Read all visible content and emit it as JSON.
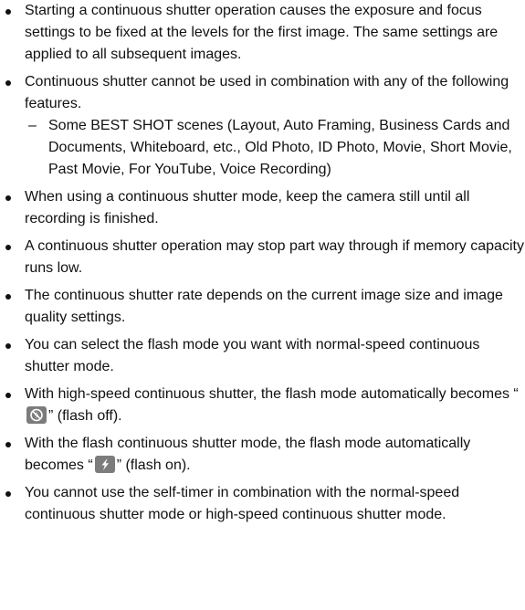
{
  "notes": [
    {
      "text": "Starting a continuous shutter operation causes the exposure and focus settings to be fixed at the levels for the first image. The same settings are applied to all subsequent images."
    },
    {
      "text": "Continuous shutter cannot be used in combination with any of the following features.",
      "sub": [
        "Some BEST SHOT scenes (Layout, Auto Framing, Business Cards and Documents, Whiteboard, etc., Old Photo, ID Photo, Movie, Short Movie, Past Movie, For YouTube, Voice Recording)"
      ]
    },
    {
      "text": "When using a continuous shutter mode, keep the camera still until all recording is finished."
    },
    {
      "text": "A continuous shutter operation may stop part way through if memory capacity runs low."
    },
    {
      "text": "The continuous shutter rate depends on the current image size and image quality settings."
    },
    {
      "text": "You can select the flash mode you want with normal-speed continuous shutter mode."
    },
    {
      "before": "With high-speed continuous shutter, the flash mode automatically becomes “",
      "icon": "flash-off-icon",
      "after": "” (flash off)."
    },
    {
      "before": "With the flash continuous shutter mode, the flash mode automatically becomes “",
      "icon": "flash-on-icon",
      "after": "” (flash on)."
    },
    {
      "text": "You cannot use the self-timer in combination with the normal-speed continuous shutter mode or high-speed continuous shutter mode."
    }
  ],
  "sub_marker": "–",
  "colors": {
    "text": "#111111",
    "icon_background": "#7c7c7c",
    "icon_foreground": "#ffffff"
  }
}
